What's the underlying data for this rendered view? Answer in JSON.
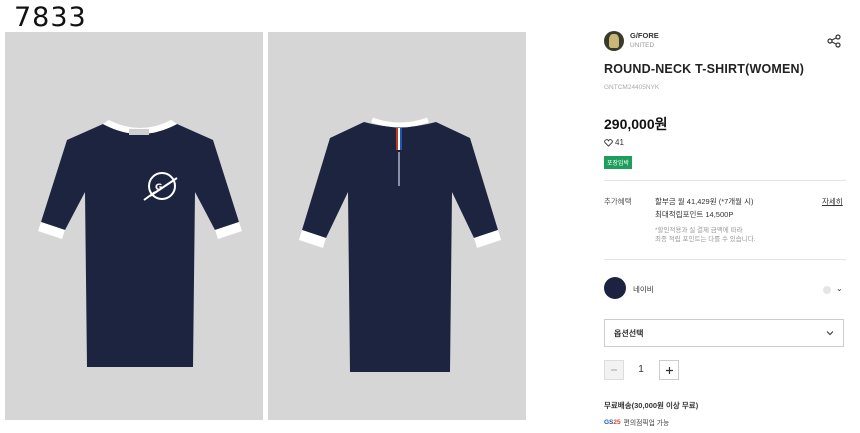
{
  "page_label": "7833",
  "brand": {
    "name": "G/FORE",
    "sub": "UNITED"
  },
  "product": {
    "title": "ROUND-NECK T-SHIRT(WOMEN)",
    "sku": "GNTCM24405NYK",
    "price": "290,000원",
    "likes": "41",
    "badge": "포장임박"
  },
  "extra_benefits": {
    "label": "추가혜택",
    "installment": "할부금 월 41,429원 (*7개월 시)",
    "points": "최대적립포인트 14,500P",
    "note1": "*할인적용과 실 결제 금액에 따라",
    "note2": "최종 적립 포인트는 다를 수 있습니다.",
    "detail_link": "자세히"
  },
  "color": {
    "name": "네이비",
    "swatch": "#1c2340"
  },
  "option": {
    "placeholder": "옵션선택"
  },
  "quantity": {
    "value": "1",
    "minus": "−",
    "plus": "+"
  },
  "shipping": "무료배송(30,000원 이상 무료)",
  "store": {
    "logo_g": "GS",
    "logo_n": "25",
    "text": "편의점픽업 가능"
  },
  "colors": {
    "shirt": "#1d2440",
    "trim": "#ffffff",
    "bg": "#d6d6d6",
    "badge": "#1e9e5a"
  }
}
